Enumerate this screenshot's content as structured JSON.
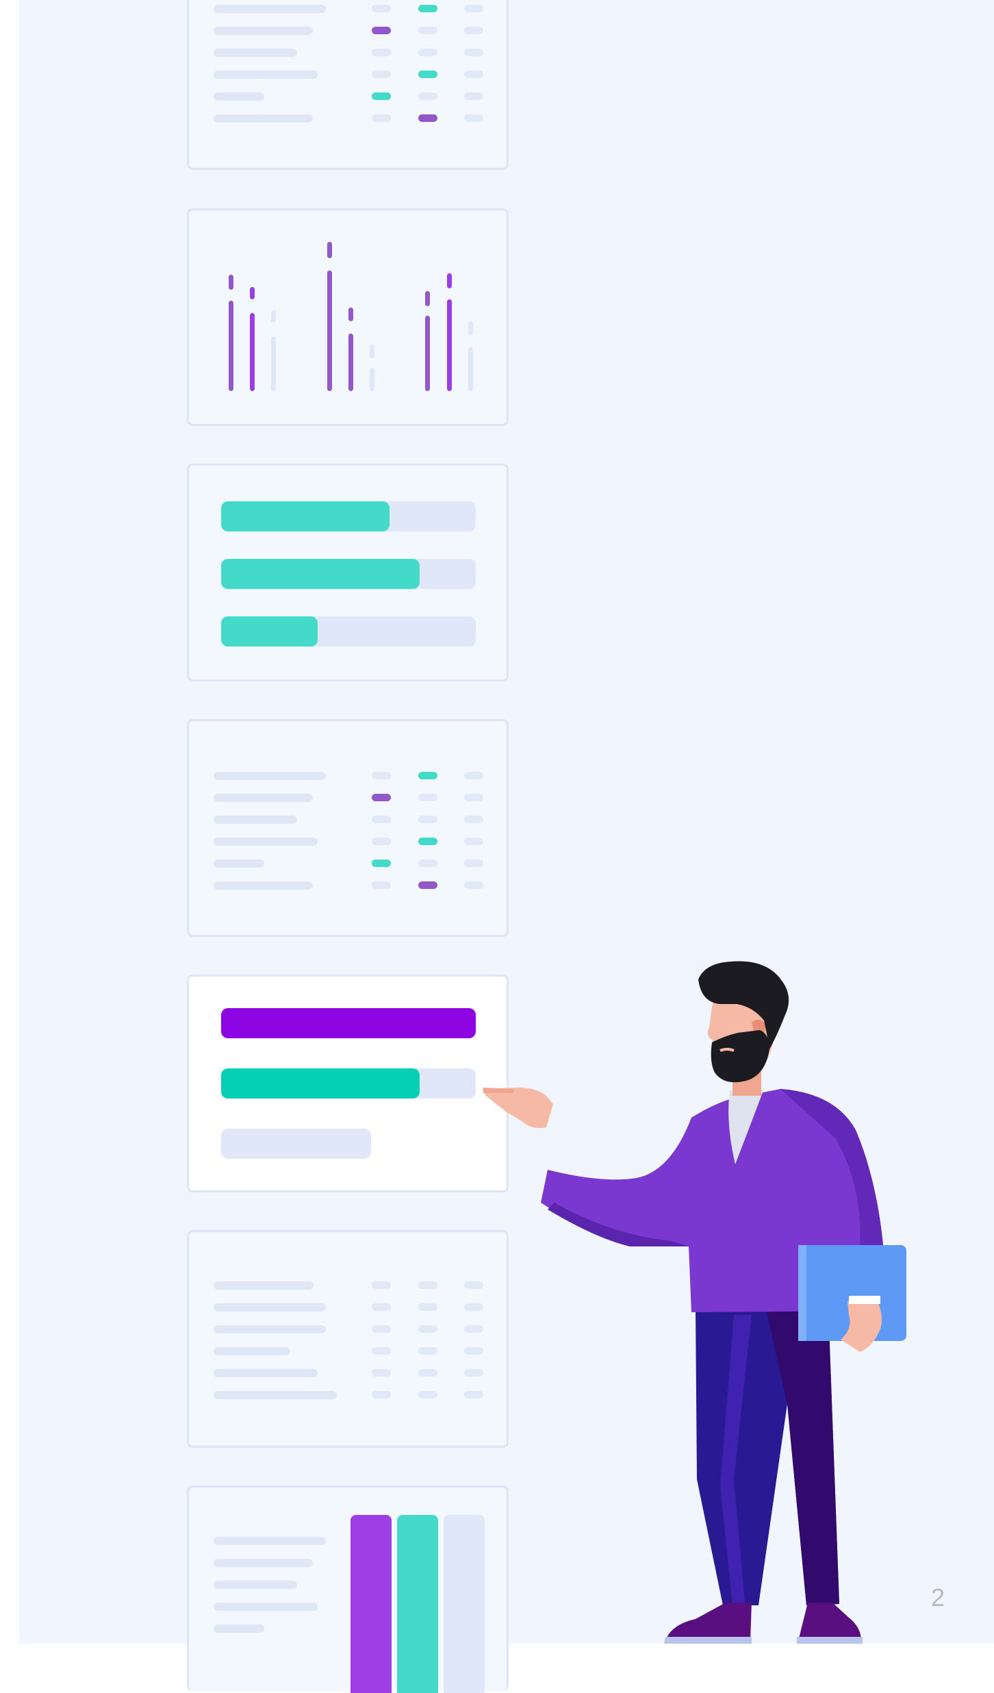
{
  "page": {
    "number": "2"
  },
  "colors": {
    "background": "#f1f6fe",
    "card_border": "#dde6f7",
    "placeholder": "#dfe7f7",
    "purple": "#8e05e3",
    "purple_soft": "#9257c9",
    "teal": "#05d0b6",
    "teal_soft": "#43dac9",
    "track": "#dfe7f8",
    "shirt": "#7b38d1",
    "pants": "#291a94",
    "folder": "#5d99f5"
  },
  "cards": [
    {
      "kind": "table-placeholder",
      "state": "inactive"
    },
    {
      "kind": "spike-chart",
      "state": "inactive"
    },
    {
      "kind": "progress-bars",
      "state": "inactive",
      "progress": [
        0.66,
        0.78,
        0.38
      ]
    },
    {
      "kind": "table-placeholder",
      "state": "inactive"
    },
    {
      "kind": "progress-bars",
      "state": "active",
      "progress": [
        1.0,
        0.78,
        0.59
      ]
    },
    {
      "kind": "table-placeholder",
      "state": "inactive"
    },
    {
      "kind": "list-with-bars",
      "state": "inactive"
    }
  ],
  "illustration": {
    "subject": "person-pointing-at-card",
    "icons": [
      "folder-icon"
    ]
  }
}
